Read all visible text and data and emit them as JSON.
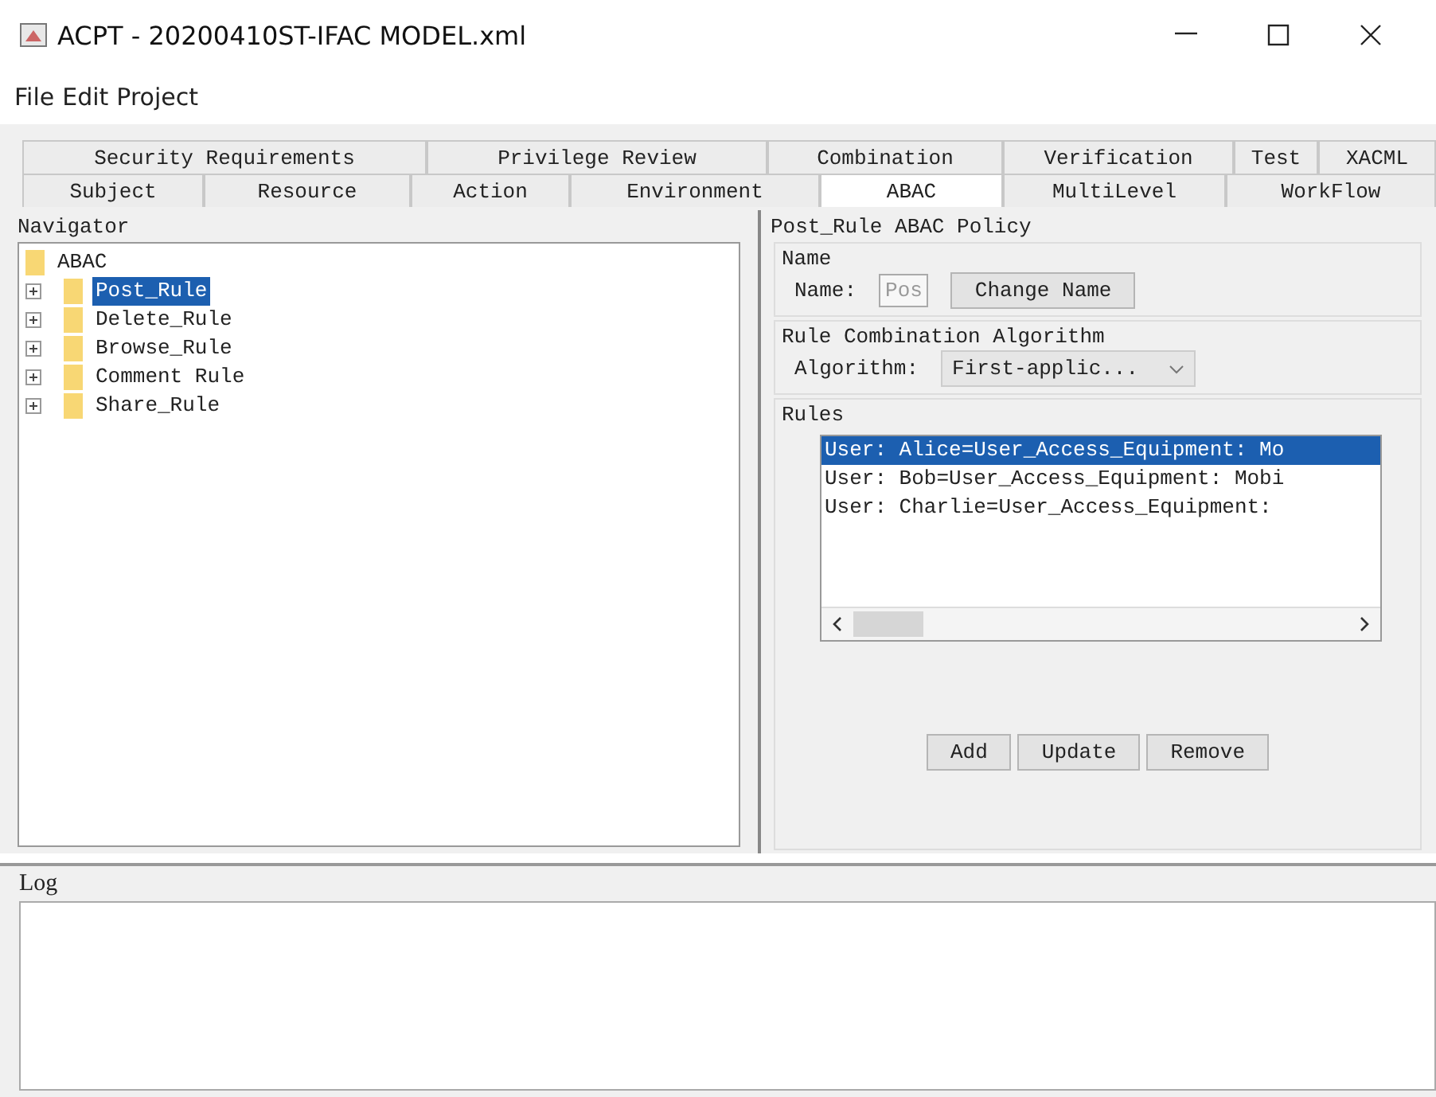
{
  "window": {
    "title": "ACPT - 20200410ST-IFAC MODEL.xml"
  },
  "menu": [
    "File",
    "Edit",
    "Project"
  ],
  "tab_rows": [
    [
      {
        "label": "Security Requirements",
        "selected": false
      },
      {
        "label": "Privilege Review",
        "selected": false
      },
      {
        "label": "Combination",
        "selected": false
      },
      {
        "label": "Verification",
        "selected": false
      },
      {
        "label": "Test",
        "selected": false
      },
      {
        "label": "XACML",
        "selected": false
      }
    ],
    [
      {
        "label": "Subject",
        "selected": false
      },
      {
        "label": "Resource",
        "selected": false
      },
      {
        "label": "Action",
        "selected": false
      },
      {
        "label": "Environment",
        "selected": false
      },
      {
        "label": "ABAC",
        "selected": true
      },
      {
        "label": "MultiLevel",
        "selected": false
      },
      {
        "label": "WorkFlow",
        "selected": false
      }
    ]
  ],
  "navigator": {
    "title": "Navigator",
    "root": {
      "label": "ABAC",
      "children": [
        {
          "label": "Post_Rule",
          "selected": true,
          "expanded": false
        },
        {
          "label": "Delete_Rule",
          "selected": false,
          "expanded": false
        },
        {
          "label": "Browse_Rule",
          "selected": false,
          "expanded": false
        },
        {
          "label": "Comment Rule",
          "selected": false,
          "expanded": false
        },
        {
          "label": "Share_Rule",
          "selected": false,
          "expanded": false
        }
      ]
    }
  },
  "policy": {
    "title": "Post_Rule ABAC Policy",
    "name_group": {
      "title": "Name",
      "label": "Name:",
      "value": "Pos",
      "disabled": true,
      "button": "Change Name"
    },
    "algorithm_group": {
      "title": "Rule Combination Algorithm",
      "label": "Algorithm:",
      "value": "First-applic..."
    },
    "rules_group": {
      "title": "Rules",
      "items": [
        {
          "text": "User: Alice=User_Access_Equipment: Mo",
          "selected": true
        },
        {
          "text": "User: Bob=User_Access_Equipment: Mobi",
          "selected": false
        },
        {
          "text": "User: Charlie=User_Access_Equipment:",
          "selected": false
        }
      ],
      "buttons": [
        "Add",
        "Update",
        "Remove"
      ]
    }
  },
  "log": {
    "title": "Log"
  }
}
